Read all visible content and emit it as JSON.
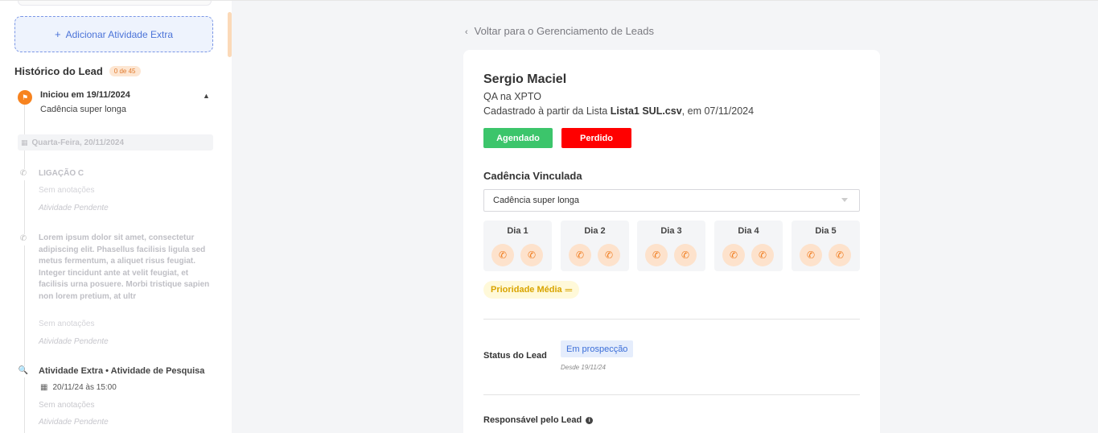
{
  "sidebar": {
    "add_extra_label": "Adicionar Atividade Extra",
    "history": {
      "title": "Histórico do Lead",
      "badge": "0 de 45"
    },
    "timeline": {
      "start": {
        "title": "Iniciou em 19/11/2024",
        "subtitle": "Cadência super longa"
      },
      "date_chip": "Quarta-Feira, 20/11/2024",
      "items": [
        {
          "title": "LIGAÇÃO C",
          "notes": "Sem anotações",
          "status": "Atividade Pendente"
        },
        {
          "title": "Lorem ipsum dolor sit amet, consectetur adipiscing elit. Phasellus facilisis ligula sed metus fermentum, a aliquet risus feugiat. Integer tincidunt ante at velit feugiat, et facilisis urna posuere. Morbi tristique sapien non lorem pretium, at ultr",
          "notes": "Sem anotações",
          "status": "Atividade Pendente"
        },
        {
          "title": "Atividade Extra • Atividade de Pesquisa",
          "date": "20/11/24 às 15:00",
          "notes": "Sem anotações",
          "status": "Atividade Pendente"
        }
      ]
    }
  },
  "main": {
    "back_link": "Voltar para o Gerenciamento de Leads",
    "lead": {
      "name": "Sergio Maciel",
      "role": "QA na XPTO",
      "source_prefix": "Cadastrado à partir da Lista ",
      "source_list": "Lista1 SUL.csv",
      "source_suffix": ", em 07/11/2024"
    },
    "buttons": {
      "agendado": "Agendado",
      "perdido": "Perdido"
    },
    "cadence": {
      "title": "Cadência Vinculada",
      "selected": "Cadência super longa",
      "days": [
        "Dia 1",
        "Dia 2",
        "Dia 3",
        "Dia 4",
        "Dia 5"
      ]
    },
    "priority": "Prioridade Média",
    "status": {
      "label": "Status do Lead",
      "value": "Em prospecção",
      "since": "Desde 19/11/24"
    },
    "responsible_label": "Responsável pelo Lead"
  },
  "colors": {
    "accent_orange": "#f7831f",
    "agendado_green": "#3cc56b",
    "perdido_red": "#ff0000",
    "status_blue": "#3b6ed8",
    "priority_yellow": "#d9a400"
  }
}
